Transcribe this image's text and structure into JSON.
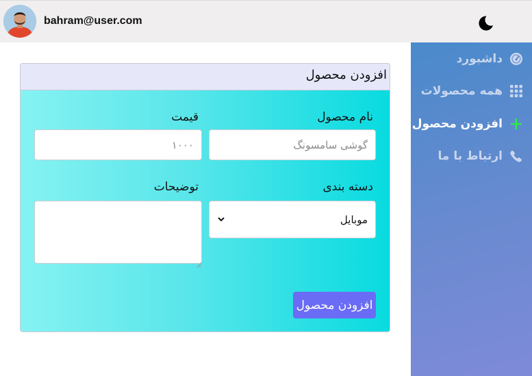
{
  "header": {
    "user_email": "bahram@user.com"
  },
  "sidebar": {
    "items": [
      {
        "label": "داشبورد",
        "icon": "gauge-icon",
        "active": false
      },
      {
        "label": "همه محصولات",
        "icon": "grid-icon",
        "active": false
      },
      {
        "label": "افزودن محصول",
        "icon": "plus-icon",
        "active": true
      },
      {
        "label": "ارتباط با ما",
        "icon": "phone-icon",
        "active": false
      }
    ]
  },
  "form": {
    "title": "افزودن محصول",
    "name_label": "نام محصول",
    "name_placeholder": "گوشی سامسونگ",
    "price_label": "قیمت",
    "price_placeholder": "۱۰۰۰",
    "category_label": "دسته بندی",
    "category_value": "موبایل",
    "description_label": "توضیحات",
    "description_value": "",
    "submit_label": "افزودن محصول"
  },
  "colors": {
    "sidebar_gradient_start": "#4a8acb",
    "sidebar_gradient_end": "#7e8ad8",
    "card_gradient_start": "#86f2f2",
    "card_gradient_end": "#08dbe0",
    "card_header": "#e6e8fa",
    "submit_button": "#6a6cf5",
    "active_plus": "#2ee84a"
  }
}
